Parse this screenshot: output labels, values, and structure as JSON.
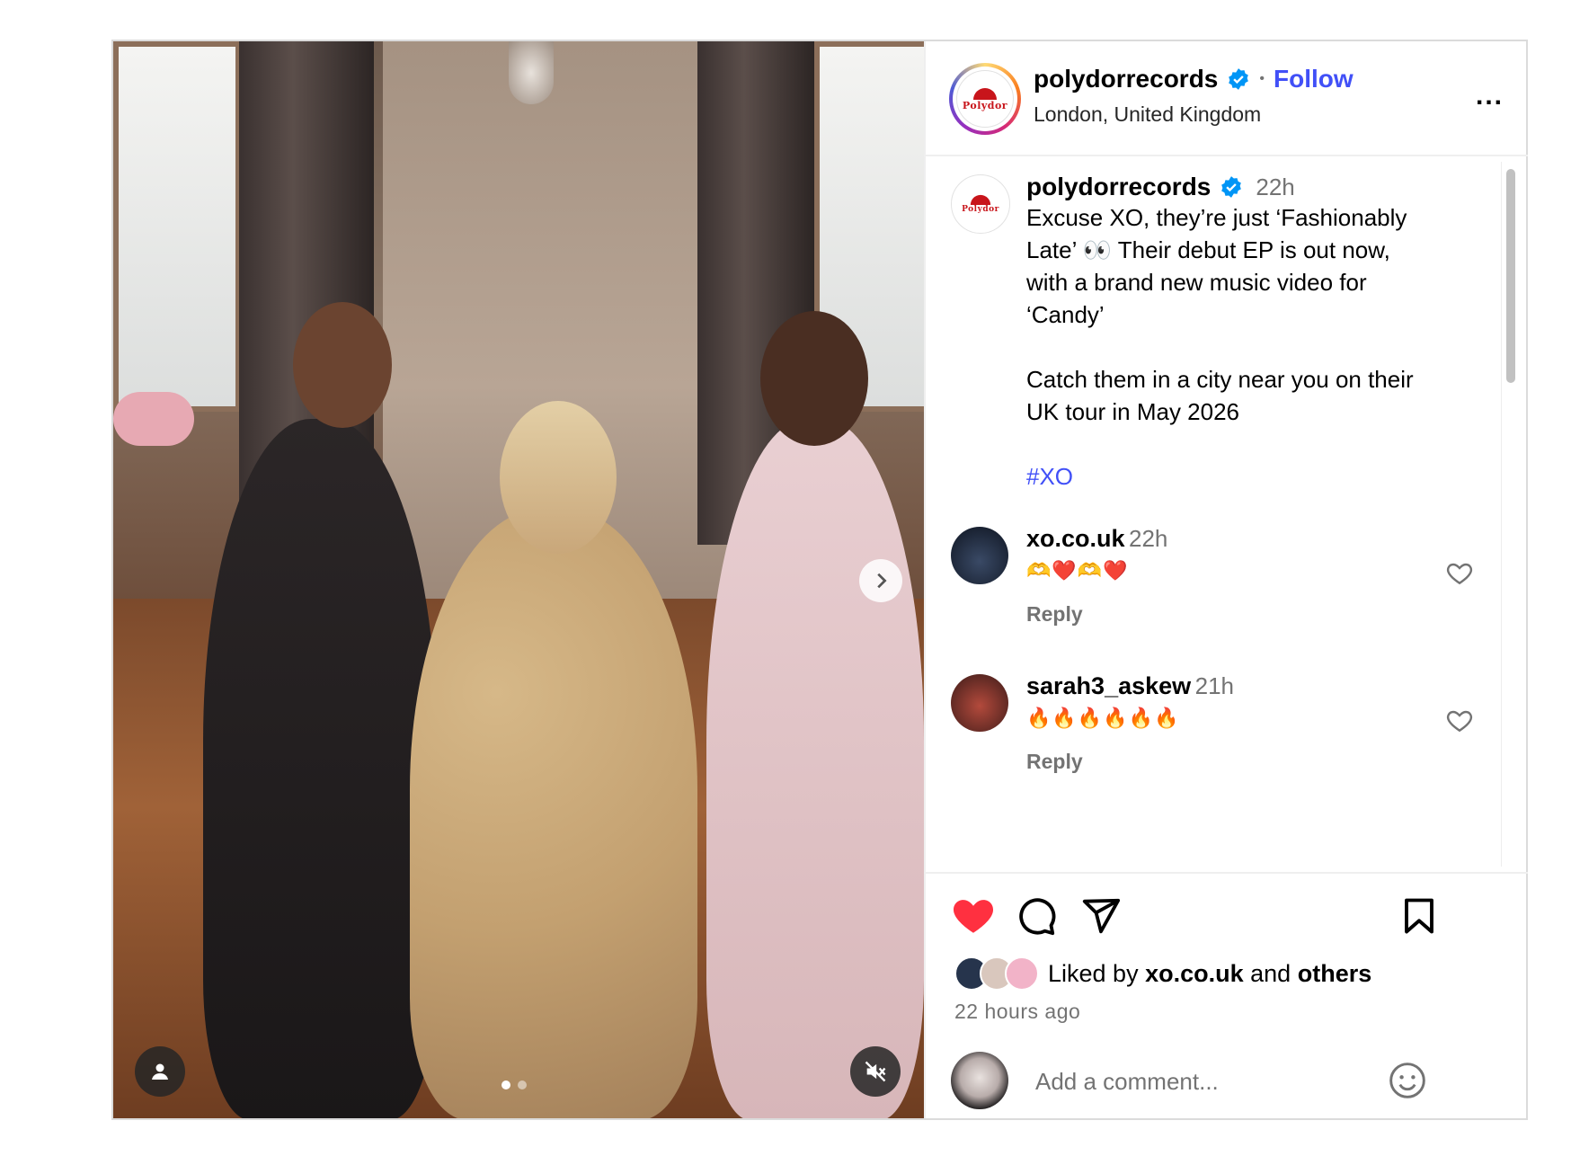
{
  "post": {
    "username": "polydorrecords",
    "follow_label": "Follow",
    "separator": "•",
    "location": "London, United Kingdom",
    "more_label": "...",
    "logo_text": "Polydor"
  },
  "caption": {
    "username": "polydorrecords",
    "time": "22h",
    "lines": [
      "Excuse XO, they’re just ‘Fashionably",
      "Late’ 👀 Their debut EP is out now,",
      "with a brand new music video for",
      "‘Candy’",
      "",
      "Catch them in a city near you on their",
      "UK tour in May 2026",
      "",
      "#XO"
    ]
  },
  "comments": [
    {
      "username": "xo.co.uk",
      "time": "22h",
      "text": "🫶❤️🫶❤️",
      "reply_label": "Reply"
    },
    {
      "username": "sarah3_askew",
      "time": "21h",
      "text": "🔥🔥🔥🔥🔥🔥",
      "reply_label": "Reply"
    }
  ],
  "likes": {
    "prefix": "Liked by",
    "user": "xo.co.uk",
    "conjunction": "and",
    "others": "others"
  },
  "timestamp": "22 hours ago",
  "add_comment": {
    "placeholder": "Add a comment..."
  },
  "media": {
    "slide_count": 2,
    "active_slide": 1,
    "icons": [
      "user-tag-icon",
      "muted-audio-icon",
      "next-arrow-icon"
    ]
  },
  "colors": {
    "accent": "#4150f7",
    "like_red": "#ff3040",
    "verified": "#0095f6",
    "muted_text": "#737373"
  }
}
